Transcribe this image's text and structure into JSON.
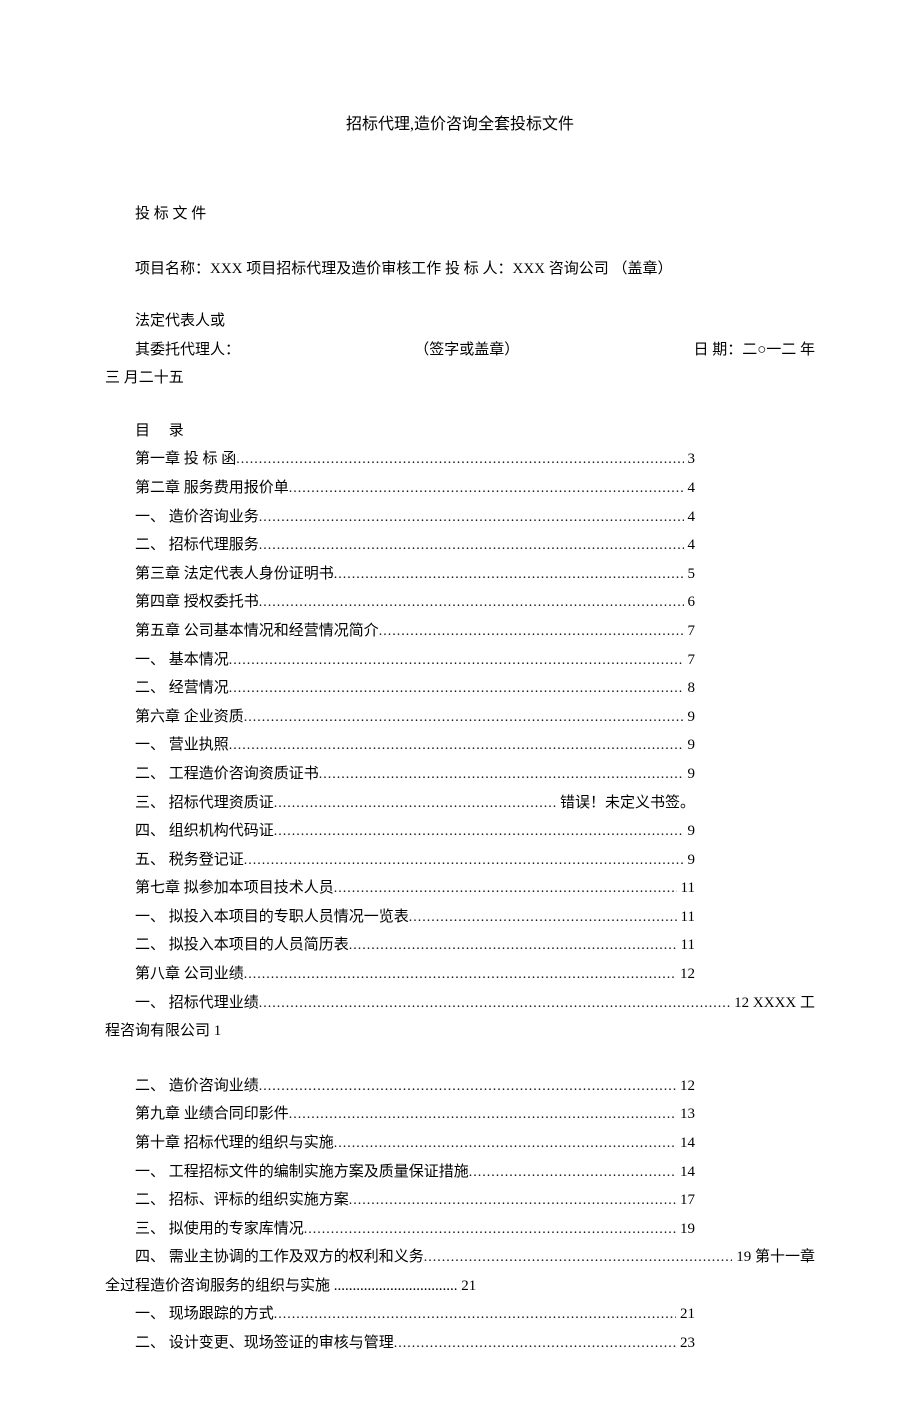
{
  "title": "招标代理,造价咨询全套投标文件",
  "subtitle": "投 标 文 件",
  "projectLine": "项目名称：XXX 项目招标代理及造价审核工作  投 标  人：XXX 咨询公司   （盖章）",
  "legalRep1": "法定代表人或",
  "legalRep2a": "其委托代理人：",
  "legalRep2b": "（签字或盖章）",
  "legalRep2c": "日       期：二○一二  年",
  "legalRep3": "三 月二十五",
  "tocHeader": "目  录",
  "toc": [
    {
      "indent": 1,
      "label": "第一章 投 标 函 ",
      "page": " 3",
      "wide": false
    },
    {
      "indent": 1,
      "label": "第二章 服务费用报价单 ",
      "page": " 4",
      "wide": false
    },
    {
      "indent": 2,
      "label": "一、  造价咨询业务",
      "page": " 4",
      "wide": false
    },
    {
      "indent": 2,
      "label": "二、  招标代理服务",
      "page": " 4",
      "wide": false
    },
    {
      "indent": 1,
      "label": "第三章 法定代表人身份证明书 ",
      "page": " 5",
      "wide": false
    },
    {
      "indent": 1,
      "label": "第四章 授权委托书 ",
      "page": " 6",
      "wide": false
    },
    {
      "indent": 1,
      "label": "第五章 公司基本情况和经营情况简介 ",
      "page": " 7",
      "wide": false
    },
    {
      "indent": 2,
      "label": "一、  基本情况",
      "page": " 7",
      "wide": false
    },
    {
      "indent": 2,
      "label": "二、  经营情况",
      "page": " 8",
      "wide": false
    },
    {
      "indent": 1,
      "label": "第六章 企业资质 ",
      "page": " 9",
      "wide": false
    },
    {
      "indent": 2,
      "label": "一、  营业执照         ",
      "page": " 9",
      "wide": false
    },
    {
      "indent": 2,
      "label": "二、  工程造价咨询资质证书",
      "page": " 9",
      "wide": false
    },
    {
      "indent": 2,
      "label": "三、  招标代理资质证",
      "page": " 错误！未定义书签。",
      "wide": false
    },
    {
      "indent": 2,
      "label": "四、  组织机构代码证",
      "page": " 9",
      "wide": false
    },
    {
      "indent": 2,
      "label": "五、  税务登记证",
      "page": " 9",
      "wide": false
    },
    {
      "indent": 1,
      "label": "第七章 拟参加本项目技术人员 ",
      "page": " 11",
      "wide": false
    },
    {
      "indent": 2,
      "label": "一、  拟投入本项目的专职人员情况一览表",
      "page": " 11",
      "wide": false
    },
    {
      "indent": 2,
      "label": "二、  拟投入本项目的人员简历表",
      "page": " 11",
      "wide": false
    },
    {
      "indent": 1,
      "label": "第八章 公司业绩 ",
      "page": " 12",
      "wide": false
    },
    {
      "indent": 2,
      "label": "一、  招标代理业绩",
      "page": " 12 XXXX 工",
      "wide": true,
      "append": "程咨询有限公司  1"
    }
  ],
  "toc2": [
    {
      "indent": 2,
      "label": "二、  造价咨询业绩",
      "page": " 12",
      "wide": false
    },
    {
      "indent": 1,
      "label": "第九章 业绩合同印影件 ",
      "page": " 13",
      "wide": false
    },
    {
      "indent": 1,
      "label": "第十章 招标代理的组织与实施 ",
      "page": " 14",
      "wide": false
    },
    {
      "indent": 2,
      "label": "一、  工程招标文件的编制实施方案及质量保证措施",
      "page": " 14",
      "wide": false
    },
    {
      "indent": 2,
      "label": "二、  招标、评标的组织实施方案",
      "page": " 17",
      "wide": false
    },
    {
      "indent": 2,
      "label": "三、  拟使用的专家库情况",
      "page": " 19",
      "wide": false
    },
    {
      "indent": 2,
      "label": "四、  需业主协调的工作及双方的权利和义务",
      "page": " 19  第十一章",
      "wide": true,
      "append": "全过程造价咨询服务的组织与实施  ................................. 21"
    },
    {
      "indent": 2,
      "label": "一、  现场跟踪的方式",
      "page": " 21",
      "wide": false
    },
    {
      "indent": 2,
      "label": "二、  设计变更、现场签证的审核与管理",
      "page": " 23",
      "wide": false
    }
  ]
}
